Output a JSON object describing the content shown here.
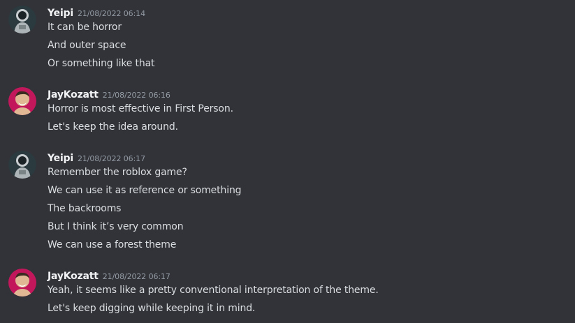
{
  "messages": [
    {
      "user": "Yeipi",
      "avatar": "astronaut-avatar-icon",
      "timestamp": "21/08/2022 06:14",
      "lines": [
        "It can be horror",
        "And outer space",
        "Or something like that"
      ]
    },
    {
      "user": "JayKozatt",
      "avatar": "man-avatar-icon",
      "timestamp": "21/08/2022 06:16",
      "lines": [
        "Horror is most effective in First Person.",
        "Let's keep the idea around."
      ]
    },
    {
      "user": "Yeipi",
      "avatar": "astronaut-avatar-icon",
      "timestamp": "21/08/2022 06:17",
      "lines": [
        "Remember the roblox game?",
        "We can use it as reference or something",
        "The backrooms",
        "But I think it’s very common",
        "We can use a forest theme"
      ]
    },
    {
      "user": "JayKozatt",
      "avatar": "man-avatar-icon",
      "timestamp": "21/08/2022 06:17",
      "lines": [
        "Yeah, it seems like a pretty conventional interpretation of the theme.",
        "Let's keep digging while keeping it in mind."
      ]
    }
  ],
  "colors": {
    "background": "#313338",
    "username": "#f2f3f5",
    "timestamp": "#949ba4",
    "text": "#dbdee1"
  }
}
